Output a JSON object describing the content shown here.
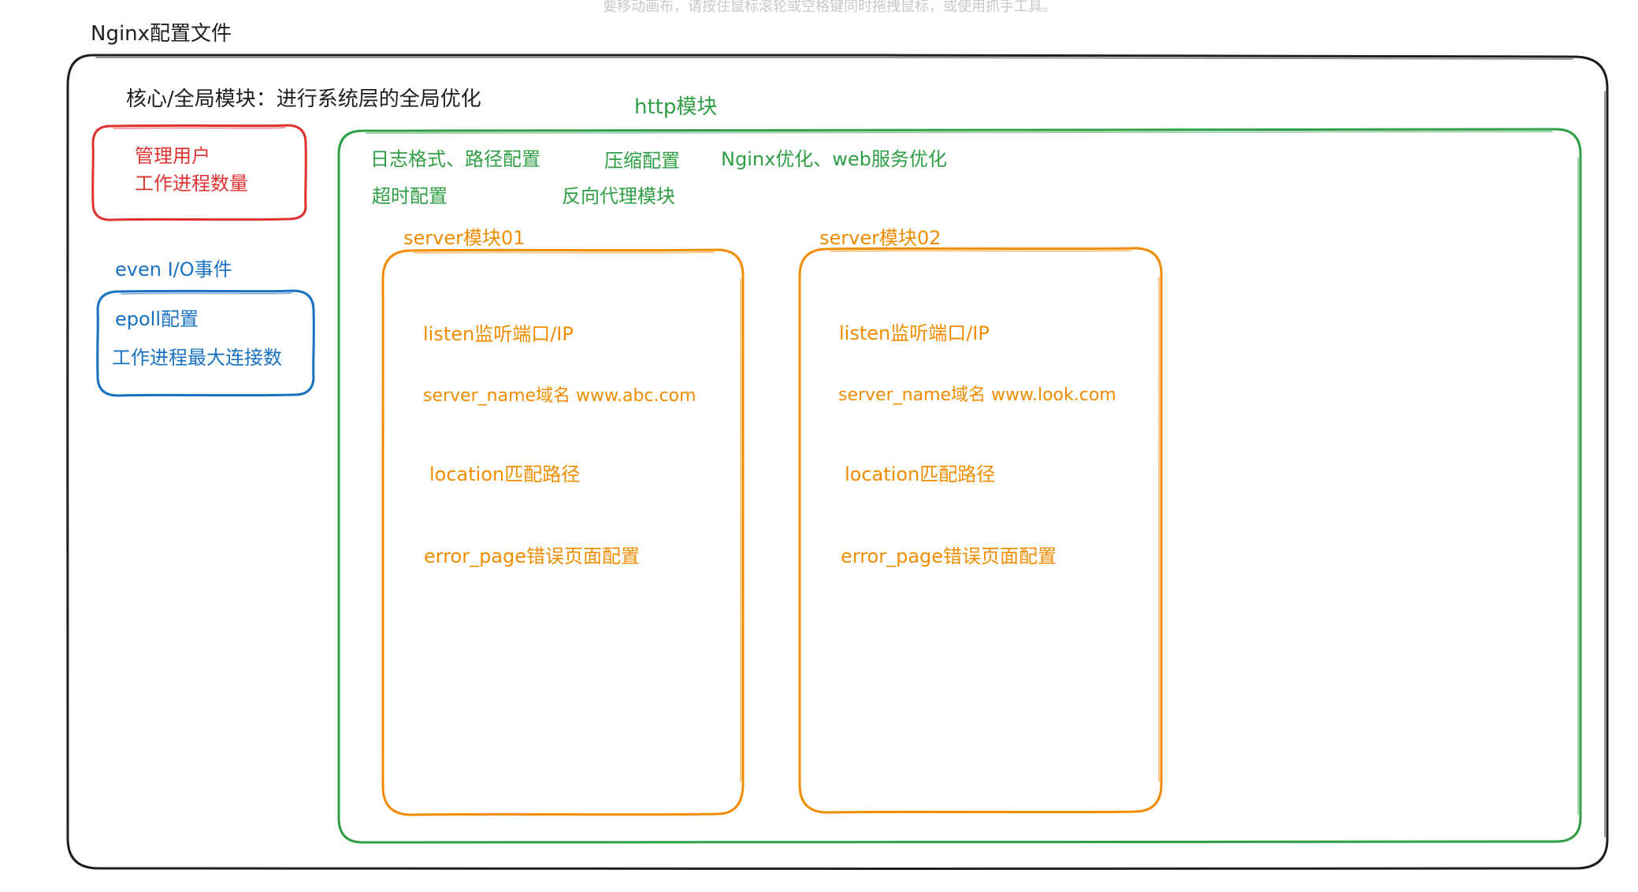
{
  "hint_text": "要移动画布，请按住鼠标滚轮或空格键同时拖拽鼠标，或使用抓手工具。",
  "outer": {
    "title": "Nginx配置文件"
  },
  "core": {
    "title": "核心/全局模块：进行系统层的全局优化",
    "red_box": {
      "line1": "管理用户",
      "line2": "工作进程数量"
    }
  },
  "event": {
    "title": "even I/O事件",
    "line1": "epoll配置",
    "line2": "工作进程最大连接数"
  },
  "http": {
    "title": "http模块",
    "items": [
      "日志格式、路径配置",
      "压缩配置",
      "Nginx优化、web服务优化",
      "超时配置",
      "反向代理模块"
    ]
  },
  "servers": [
    {
      "title": "server模块01",
      "listen": "listen监听端口/IP",
      "server_name": "server_name域名 www.abc.com",
      "location": "location匹配路径",
      "error_page": "error_page错误页面配置"
    },
    {
      "title": "server模块02",
      "listen": "listen监听端口/IP",
      "server_name": "server_name域名 www.look.com",
      "location": "location匹配路径",
      "error_page": "error_page错误页面配置"
    }
  ],
  "colors": {
    "outer": "#1e1e1e",
    "core": "#e03131",
    "event": "#1971c2",
    "http": "#2f9e44",
    "server": "#f08c00"
  }
}
